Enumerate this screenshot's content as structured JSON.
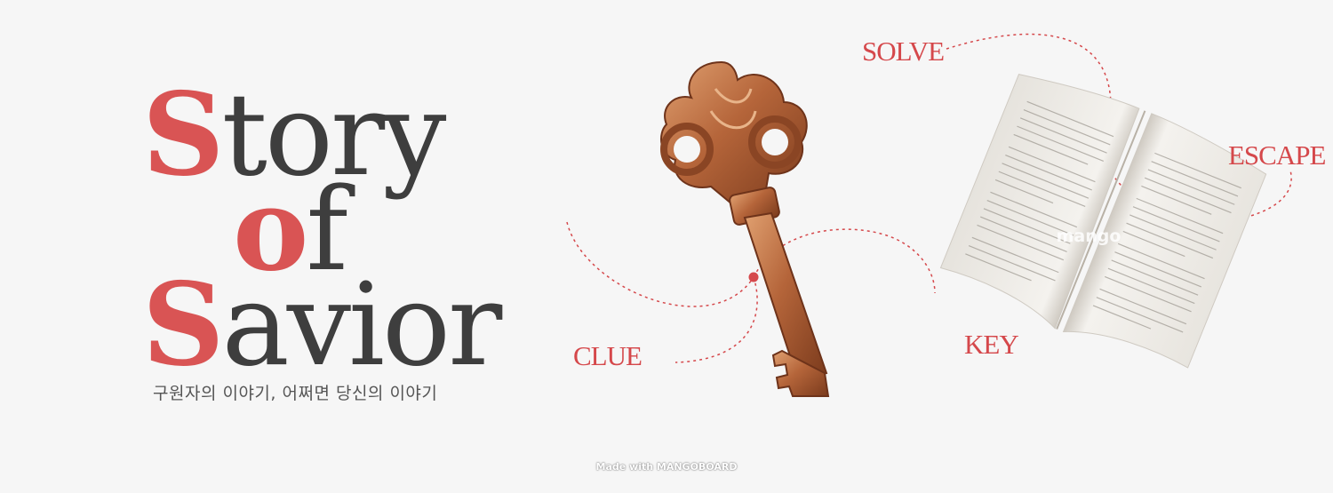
{
  "title": {
    "line1": {
      "cap": "S",
      "rest": "tory"
    },
    "line2": {
      "cap": "o",
      "rest": "f"
    },
    "line3": {
      "cap": "S",
      "rest": "avior"
    },
    "subtitle": "구원자의 이야기, 어쩌면 당신의 이야기"
  },
  "labels": {
    "solve": "SOLVE",
    "escape": "ESCAPE",
    "key": "KEY",
    "clue": "CLUE"
  },
  "book_watermark": "mango",
  "footer": "Made with MANGOBOARD",
  "colors": {
    "accent": "#d5484b",
    "title_text": "#3e3e3e",
    "background": "#f6f6f6",
    "key_metal": "#b5653a"
  }
}
